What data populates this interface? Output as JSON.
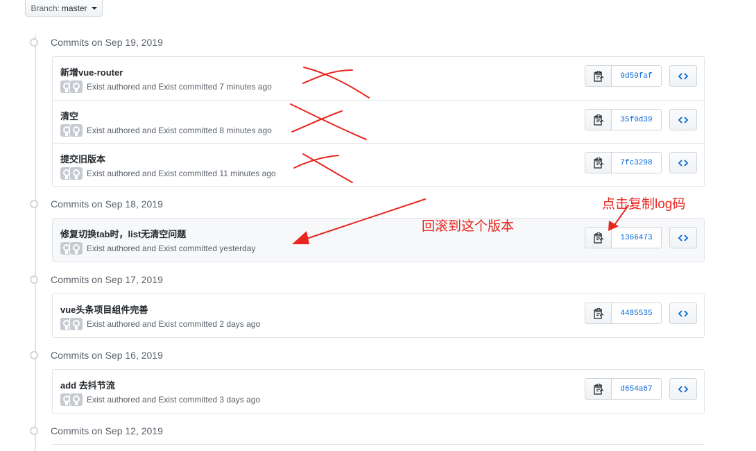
{
  "branch": {
    "prefix": "Branch:",
    "name": "master"
  },
  "groups": [
    {
      "title": "Commits on Sep 19, 2019",
      "commits": [
        {
          "message": "新增vue-router",
          "meta": "Exist authored and Exist committed 7 minutes ago",
          "sha": "9d59faf"
        },
        {
          "message": "清空",
          "meta": "Exist authored and Exist committed 8 minutes ago",
          "sha": "35f0d39"
        },
        {
          "message": "提交旧版本",
          "meta": "Exist authored and Exist committed 11 minutes ago",
          "sha": "7fc3298"
        }
      ]
    },
    {
      "title": "Commits on Sep 18, 2019",
      "commits": [
        {
          "message": "修复切换tab时，list无清空问题",
          "meta": "Exist authored and Exist committed yesterday",
          "sha": "1366473"
        }
      ]
    },
    {
      "title": "Commits on Sep 17, 2019",
      "commits": [
        {
          "message": "vue头条项目组件完善",
          "meta": "Exist authored and Exist committed 2 days ago",
          "sha": "4485535"
        }
      ]
    },
    {
      "title": "Commits on Sep 16, 2019",
      "commits": [
        {
          "message": "add 去抖节流",
          "meta": "Exist authored and Exist committed 3 days ago",
          "sha": "d654a67"
        }
      ]
    },
    {
      "title": "Commits on Sep 12, 2019",
      "commits": []
    }
  ],
  "annotations": {
    "rollback": "回滚到这个版本",
    "copy_log": "点击复制log码",
    "color": "#e8261f"
  },
  "colors": {
    "link": "#0366d6",
    "border": "#e1e4e8",
    "highlight": "#f6f8fa"
  }
}
